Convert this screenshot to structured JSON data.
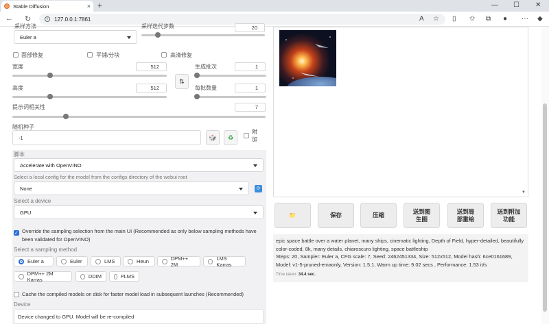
{
  "browser": {
    "tab_title": "Stable Diffusion",
    "url": "127.0.0.1:7861",
    "new_tab": "+",
    "minimize": "—",
    "maximize": "☐",
    "close": "✕"
  },
  "top": {
    "sampler_label": "采样方法",
    "sampler_value": "Euler a",
    "steps_label": "采样迭代步数",
    "steps_value": "20"
  },
  "checks": {
    "face_restore": "面部修复",
    "tiling": "平铺/分块",
    "hires": "高清修复"
  },
  "width": {
    "label": "宽度",
    "value": "512",
    "fraction": 0.234
  },
  "height": {
    "label": "高度",
    "value": "512",
    "fraction": 0.234
  },
  "batch_count": {
    "label": "生成批次",
    "value": "1",
    "fraction": 0.0
  },
  "batch_size": {
    "label": "每批数量",
    "value": "1",
    "fraction": 0.0
  },
  "cfg": {
    "label": "提示词相关性",
    "value": "7",
    "fraction": 0.2
  },
  "seed": {
    "label": "随机种子",
    "value": "-1",
    "extra": "附加"
  },
  "script": {
    "label": "脚本",
    "value": "Accelerate with OpenVINO",
    "config_label": "Select a local config for the model from the configs directory of the webui root",
    "config_value": "None",
    "device_label": "Select a device",
    "device_value": "GPU",
    "override_label": "Override the sampling selection from the main UI (Recommended as only below sampling methods have been validated for OpenVINO)",
    "sampling_label": "Select a sampling method",
    "methods": [
      "Euler a",
      "Euler",
      "LMS",
      "Heun",
      "DPM++ 2M",
      "LMS Karras",
      "DPM++ 2M Karras",
      "DDIM",
      "PLMS"
    ],
    "selected_method": "Euler a",
    "cache_label": "Cache the compiled models on disk for faster model load in subsequent launches (Recommended)",
    "device_section": "Device",
    "device_message": "Device changed to GPU. Model will be re-compiled"
  },
  "actions": {
    "folder": "📁",
    "save": "保存",
    "zip": "压缩",
    "to_img2img": "送到图生图",
    "to_inpaint": "送到局部重绘",
    "to_extras": "送到附加功能"
  },
  "output": {
    "prompt": "epic space battle over a water planet, many ships, cinematic lighting, Depth of Field, hyper-detailed, beautifully color-coded, 8k, many details, chiaroscuro lighting, space battleship",
    "params": "Steps: 20, Sampler: Euler a, CFG scale: 7, Seed: 2462451334, Size: 512x512, Model hash: 6ce0161689, Model: v1-5-pruned-emaonly, Version: 1.5.1, Warm up time: 9.02 secs , Performance: 1.53 it/s",
    "time_label": "Time taken:",
    "time_value": "34.4 sec."
  },
  "colors": {
    "accent": "#2a6ed8",
    "panel_gray": "#f1f1f3"
  }
}
